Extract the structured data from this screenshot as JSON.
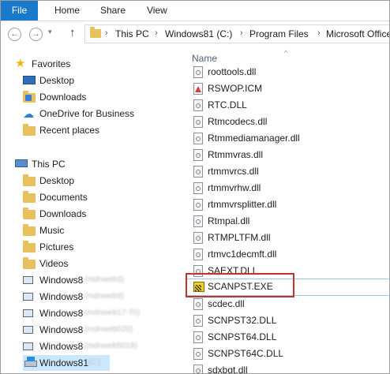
{
  "ribbon": {
    "file_tab": "File",
    "tabs": [
      "Home",
      "Share",
      "View"
    ]
  },
  "address": {
    "breadcrumbs": [
      "This PC",
      "Windows81 (C:)",
      "Program Files",
      "Microsoft Office"
    ]
  },
  "nav": {
    "favorites": {
      "label": "Favorites",
      "items": [
        "Desktop",
        "Downloads",
        "OneDrive for Business",
        "Recent places"
      ]
    },
    "this_pc": {
      "label": "This PC",
      "items": [
        "Desktop",
        "Documents",
        "Downloads",
        "Music",
        "Pictures",
        "Videos"
      ]
    },
    "network_drives": [
      {
        "label": "Windows8",
        "blurred": "(mdnweb3)"
      },
      {
        "label": "Windows8",
        "blurred": "(mdnweb9)"
      },
      {
        "label": "Windows8",
        "blurred": "(mdnweb17-70)"
      },
      {
        "label": "Windows8",
        "blurred": "(mdnweb020)"
      },
      {
        "label": "Windows8",
        "blurred": "(mdnweb5018)"
      }
    ],
    "local_drive": {
      "label": "Windows81",
      "blurred": "(C:)"
    }
  },
  "filelist": {
    "column_name": "Name",
    "files": [
      {
        "name": "roottools.dll",
        "icon": "dll"
      },
      {
        "name": "RSWOP.ICM",
        "icon": "icm"
      },
      {
        "name": "RTC.DLL",
        "icon": "dll"
      },
      {
        "name": "Rtmcodecs.dll",
        "icon": "dll"
      },
      {
        "name": "Rtmmediamanager.dll",
        "icon": "dll"
      },
      {
        "name": "Rtmmvras.dll",
        "icon": "dll"
      },
      {
        "name": "rtmmvrcs.dll",
        "icon": "dll"
      },
      {
        "name": "rtmmvrhw.dll",
        "icon": "dll"
      },
      {
        "name": "rtmmvrsplitter.dll",
        "icon": "dll"
      },
      {
        "name": "Rtmpal.dll",
        "icon": "dll"
      },
      {
        "name": "RTMPLTFM.dll",
        "icon": "dll"
      },
      {
        "name": "rtmvc1decmft.dll",
        "icon": "dll"
      },
      {
        "name": "SAEXT.DLL",
        "icon": "dll"
      },
      {
        "name": "SCANPST.EXE",
        "icon": "exe"
      },
      {
        "name": "scdec.dll",
        "icon": "dll"
      },
      {
        "name": "SCNPST32.DLL",
        "icon": "dll"
      },
      {
        "name": "SCNPST64.DLL",
        "icon": "dll"
      },
      {
        "name": "SCNPST64C.DLL",
        "icon": "dll"
      },
      {
        "name": "sdxbgt.dll",
        "icon": "dll"
      }
    ]
  },
  "colors": {
    "file_tab": "#1979ca",
    "selection": "#cce8ff",
    "highlight_box": "#c9302c"
  }
}
